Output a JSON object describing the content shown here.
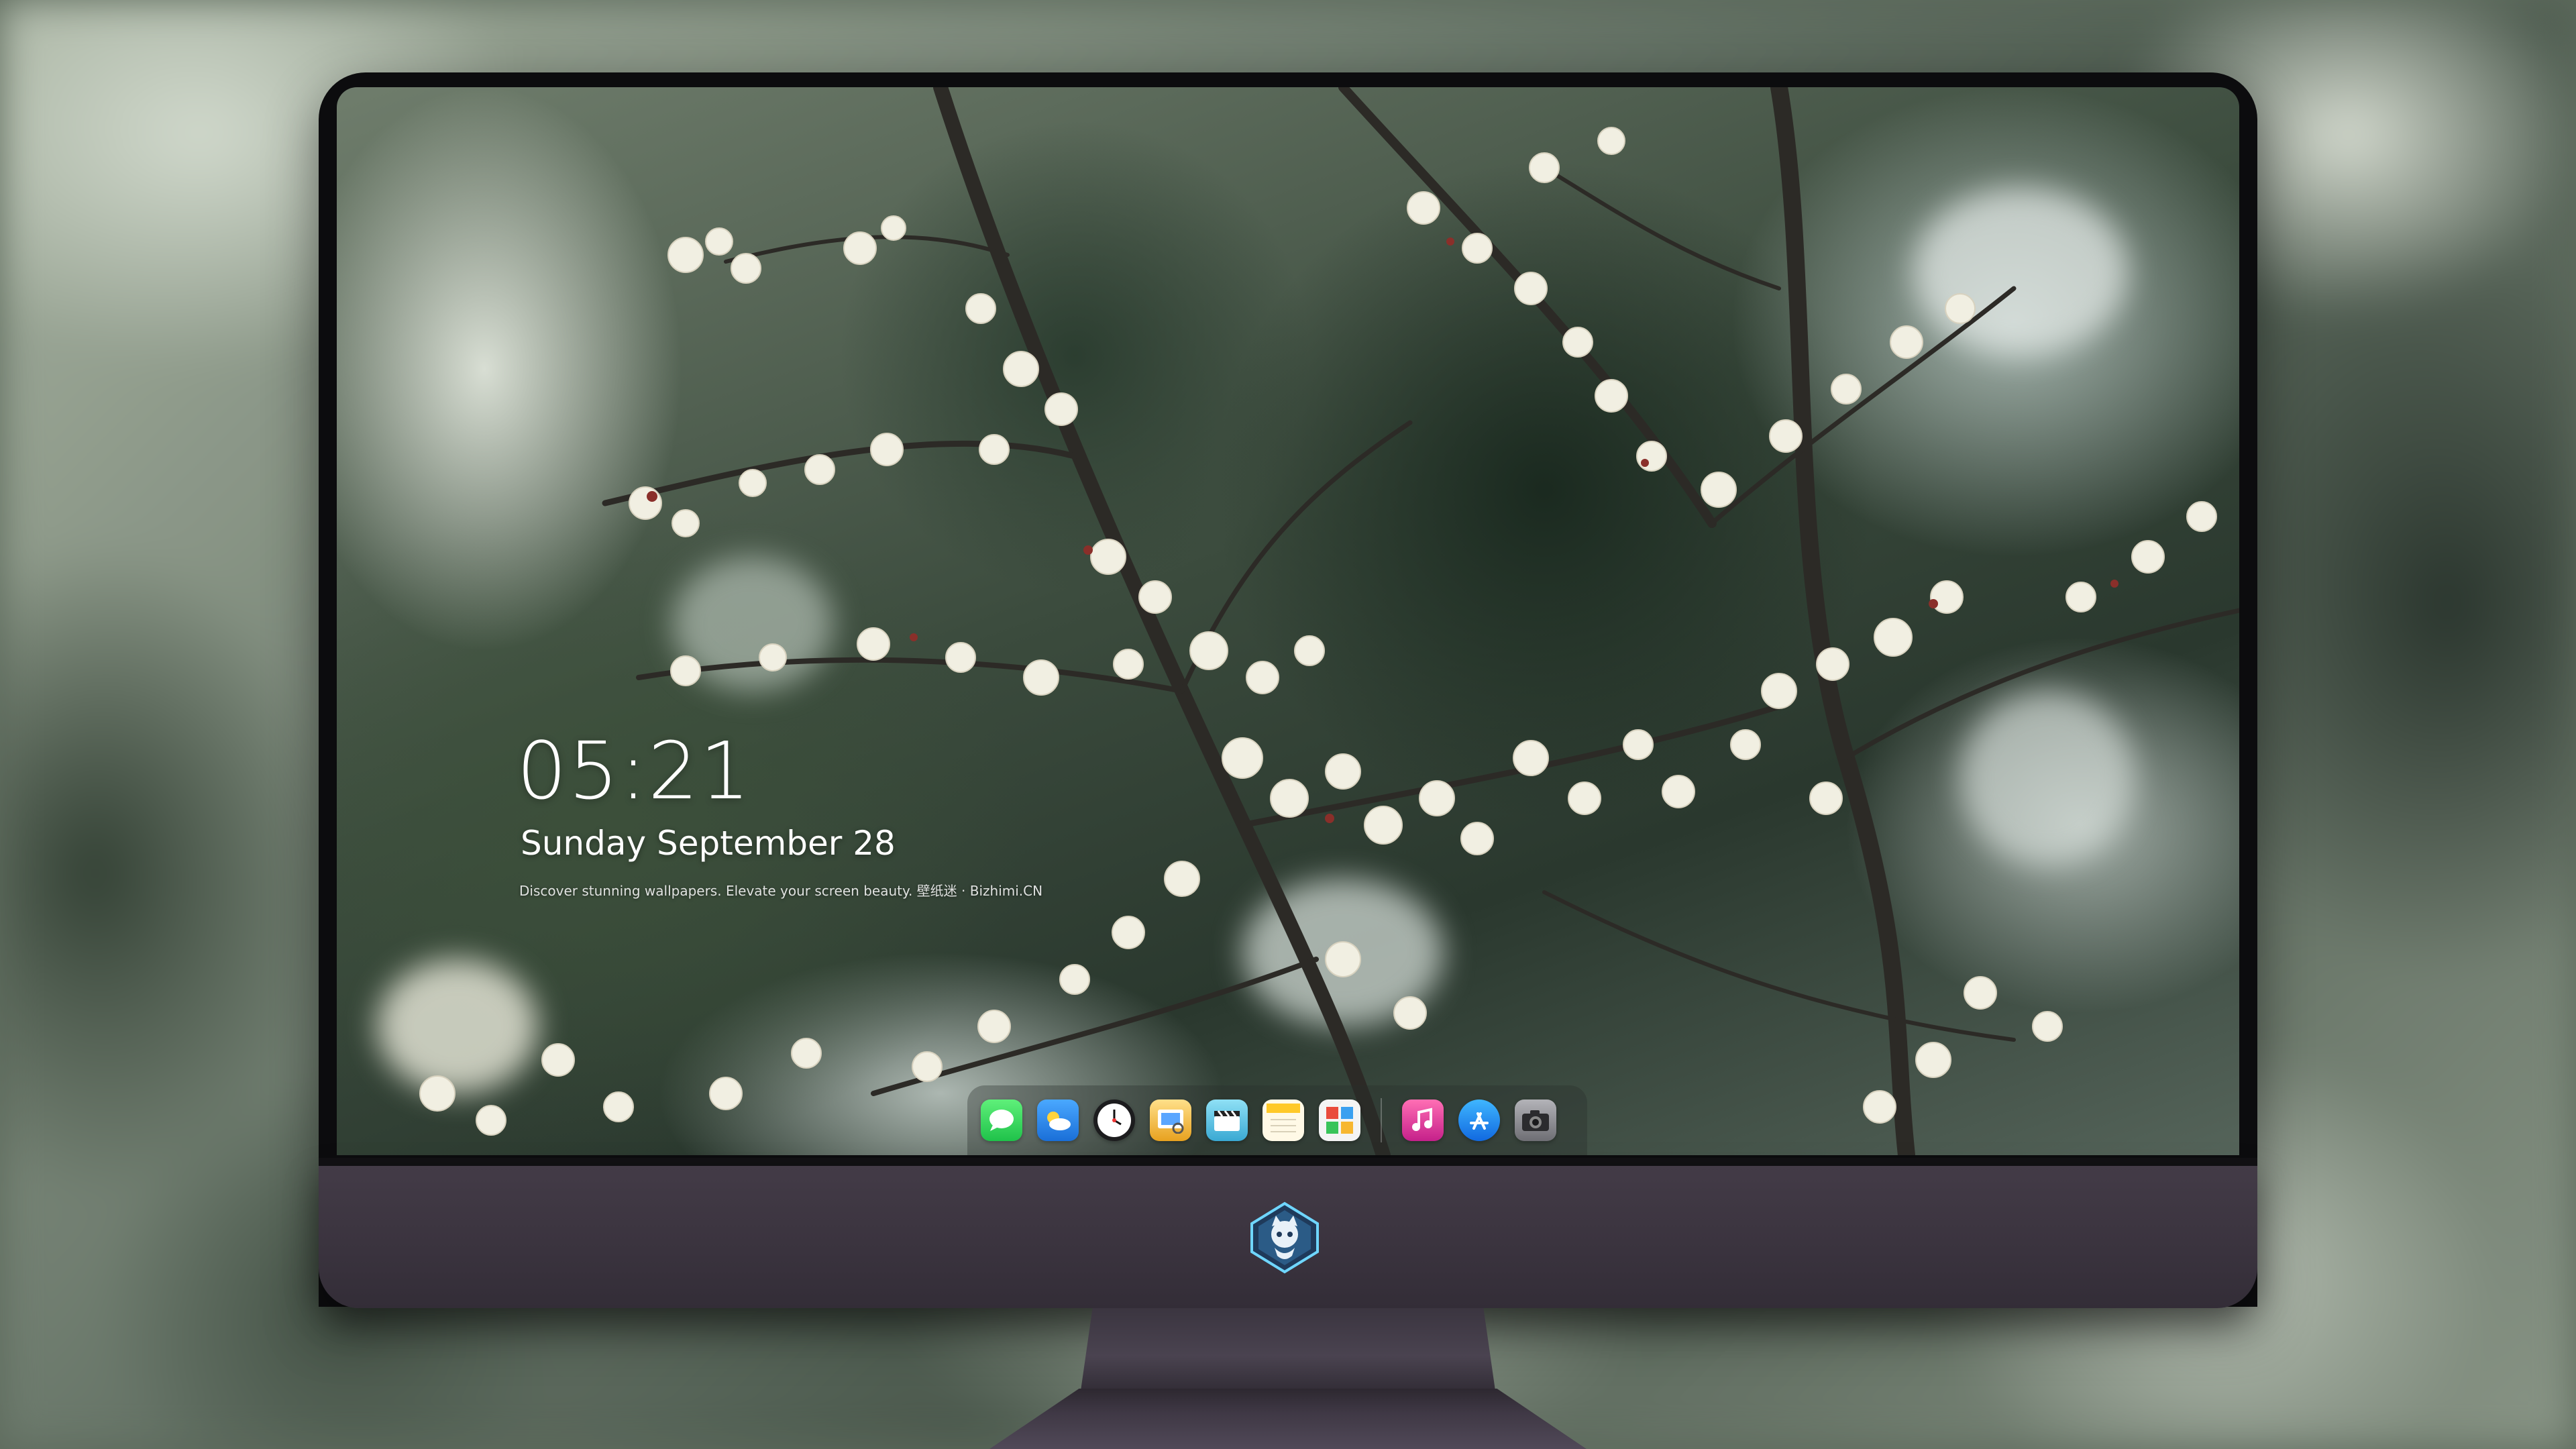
{
  "lock_screen": {
    "time": "05:21",
    "date": "Sunday September  28",
    "tagline": "Discover stunning wallpapers. Elevate your screen beauty. 壁纸迷 · Bizhimi.CN"
  },
  "dock": {
    "apps": [
      {
        "id": "messages",
        "icon": "messages-icon",
        "color": "#2fd158"
      },
      {
        "id": "weather",
        "icon": "weather-icon",
        "color": "#2f8ff0"
      },
      {
        "id": "clock",
        "icon": "clock-icon",
        "color": "#ffffff"
      },
      {
        "id": "preview",
        "icon": "preview-icon",
        "color": "#f4b63a"
      },
      {
        "id": "video",
        "icon": "clapperboard-icon",
        "color": "#5ec7e8"
      },
      {
        "id": "notes",
        "icon": "notes-icon",
        "color": "#ffd54a"
      },
      {
        "id": "photos",
        "icon": "photo-collage-icon",
        "color": "#e94b3c"
      },
      {
        "id": "music",
        "icon": "music-icon",
        "color": "#f0328e"
      },
      {
        "id": "app-store",
        "icon": "app-store-icon",
        "color": "#1e8ef5"
      },
      {
        "id": "camera",
        "icon": "camera-icon",
        "color": "#8e8e93"
      }
    ]
  }
}
